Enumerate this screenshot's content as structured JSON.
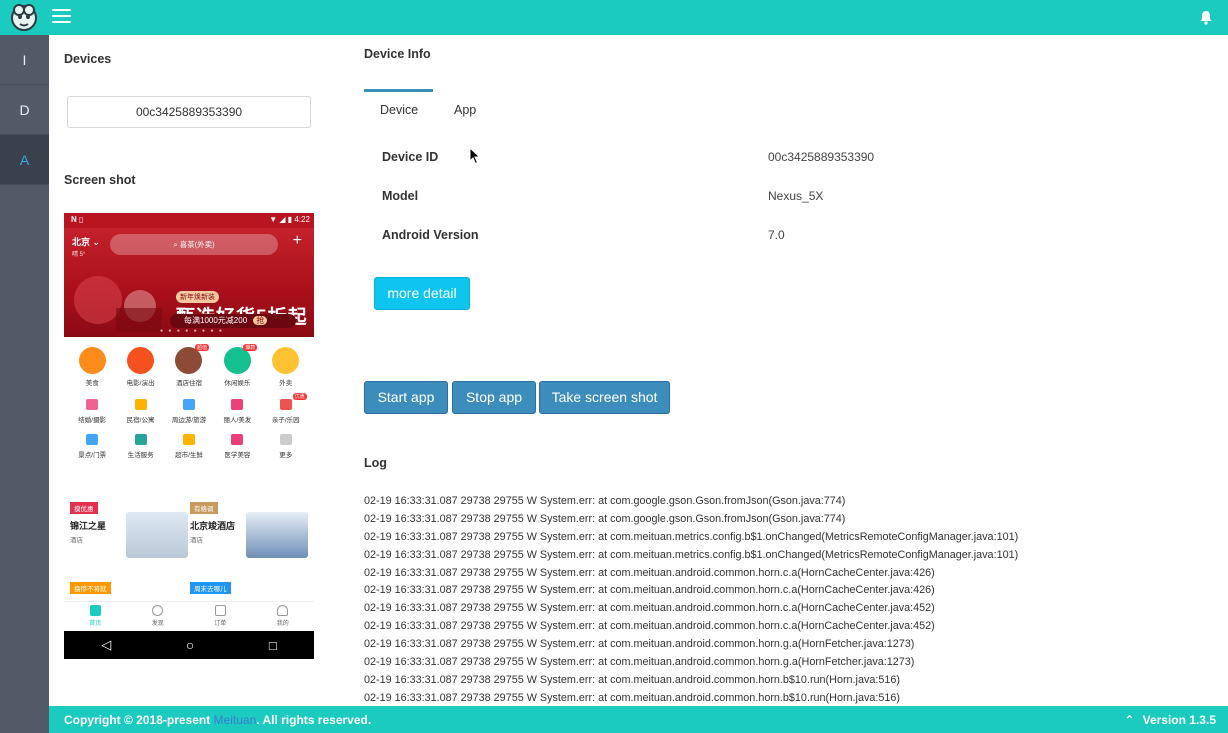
{
  "colors": {
    "accent": "#1ccbc0",
    "primary": "#3c8dbc",
    "info": "#0dc5ee",
    "sidebar": "#525a68",
    "active_text": "#35a8e6"
  },
  "sidebar": {
    "items": [
      {
        "label": "I"
      },
      {
        "label": "D"
      },
      {
        "label": "A"
      }
    ]
  },
  "devices": {
    "title": "Devices",
    "selected": "00c3425889353390"
  },
  "screenshot": {
    "title": "Screen shot",
    "phone": {
      "time": "4:22",
      "city": "北京",
      "weather": "晴 5°",
      "search_placeholder": "喜茶(外卖)",
      "plus": "+",
      "promo_tag": "新年焕新装",
      "promo_main": "甄选好货5折起",
      "promo_sub": "每满1000元减200",
      "promo_btn": "抢",
      "dots": "● ● ● ● ● ● ● ●",
      "big_categories": [
        "美食",
        "电影/演出",
        "酒店住宿",
        "休闲娱乐",
        "外卖"
      ],
      "badges": [
        "超值",
        "爆款",
        "优惠"
      ],
      "small_categories_1": [
        "结婚/摄影",
        "民宿/公寓",
        "周边游/旅游",
        "丽人/美发",
        "亲子/乐园"
      ],
      "small_categories_2": [
        "景点/门票",
        "生活服务",
        "超市/生鲜",
        "医学美容",
        "更多"
      ],
      "cards": [
        {
          "tag": "摸优惠",
          "name": "锦江之星",
          "kind": "酒店"
        },
        {
          "tag": "有格调",
          "name": "北京竣酒店",
          "kind": "酒店"
        },
        {
          "tag": "撸惨不将就",
          "name": ""
        },
        {
          "tag": "周末去哪儿",
          "name": ""
        }
      ],
      "tabs": [
        "首页",
        "发现",
        "订单",
        "我的"
      ],
      "nav": [
        "◁",
        "○",
        "□"
      ]
    }
  },
  "device_info": {
    "title": "Device Info",
    "tabs": [
      "Device",
      "App"
    ],
    "rows": [
      {
        "label": "Device ID",
        "value": "00c3425889353390"
      },
      {
        "label": "Model",
        "value": "Nexus_5X"
      },
      {
        "label": "Android Version",
        "value": "7.0"
      }
    ],
    "more_detail_label": "more detail"
  },
  "actions": {
    "start": "Start app",
    "stop": "Stop app",
    "screenshot": "Take screen shot"
  },
  "log": {
    "title": "Log",
    "lines": [
      "02-19 16:33:31.087 29738 29755 W System.err: at com.google.gson.Gson.fromJson(Gson.java:774)",
      "02-19 16:33:31.087 29738 29755 W System.err: at com.google.gson.Gson.fromJson(Gson.java:774)",
      "02-19 16:33:31.087 29738 29755 W System.err: at com.meituan.metrics.config.b$1.onChanged(MetricsRemoteConfigManager.java:101)",
      "02-19 16:33:31.087 29738 29755 W System.err: at com.meituan.metrics.config.b$1.onChanged(MetricsRemoteConfigManager.java:101)",
      "02-19 16:33:31.087 29738 29755 W System.err: at com.meituan.android.common.horn.c.a(HornCacheCenter.java:426)",
      "02-19 16:33:31.087 29738 29755 W System.err: at com.meituan.android.common.horn.c.a(HornCacheCenter.java:426)",
      "02-19 16:33:31.087 29738 29755 W System.err: at com.meituan.android.common.horn.c.a(HornCacheCenter.java:452)",
      "02-19 16:33:31.087 29738 29755 W System.err: at com.meituan.android.common.horn.c.a(HornCacheCenter.java:452)",
      "02-19 16:33:31.087 29738 29755 W System.err: at com.meituan.android.common.horn.g.a(HornFetcher.java:1273)",
      "02-19 16:33:31.087 29738 29755 W System.err: at com.meituan.android.common.horn.g.a(HornFetcher.java:1273)",
      "02-19 16:33:31.087 29738 29755 W System.err: at com.meituan.android.common.horn.b$10.run(Horn.java:516)",
      "02-19 16:33:31.087 29738 29755 W System.err: at com.meituan.android.common.horn.b$10.run(Horn.java:516)"
    ]
  },
  "footer": {
    "copyright_prefix": "Copyright © 2018-present ",
    "brand": "Meituan",
    "copyright_suffix": ". All rights reserved.",
    "version": "Version 1.3.5"
  }
}
